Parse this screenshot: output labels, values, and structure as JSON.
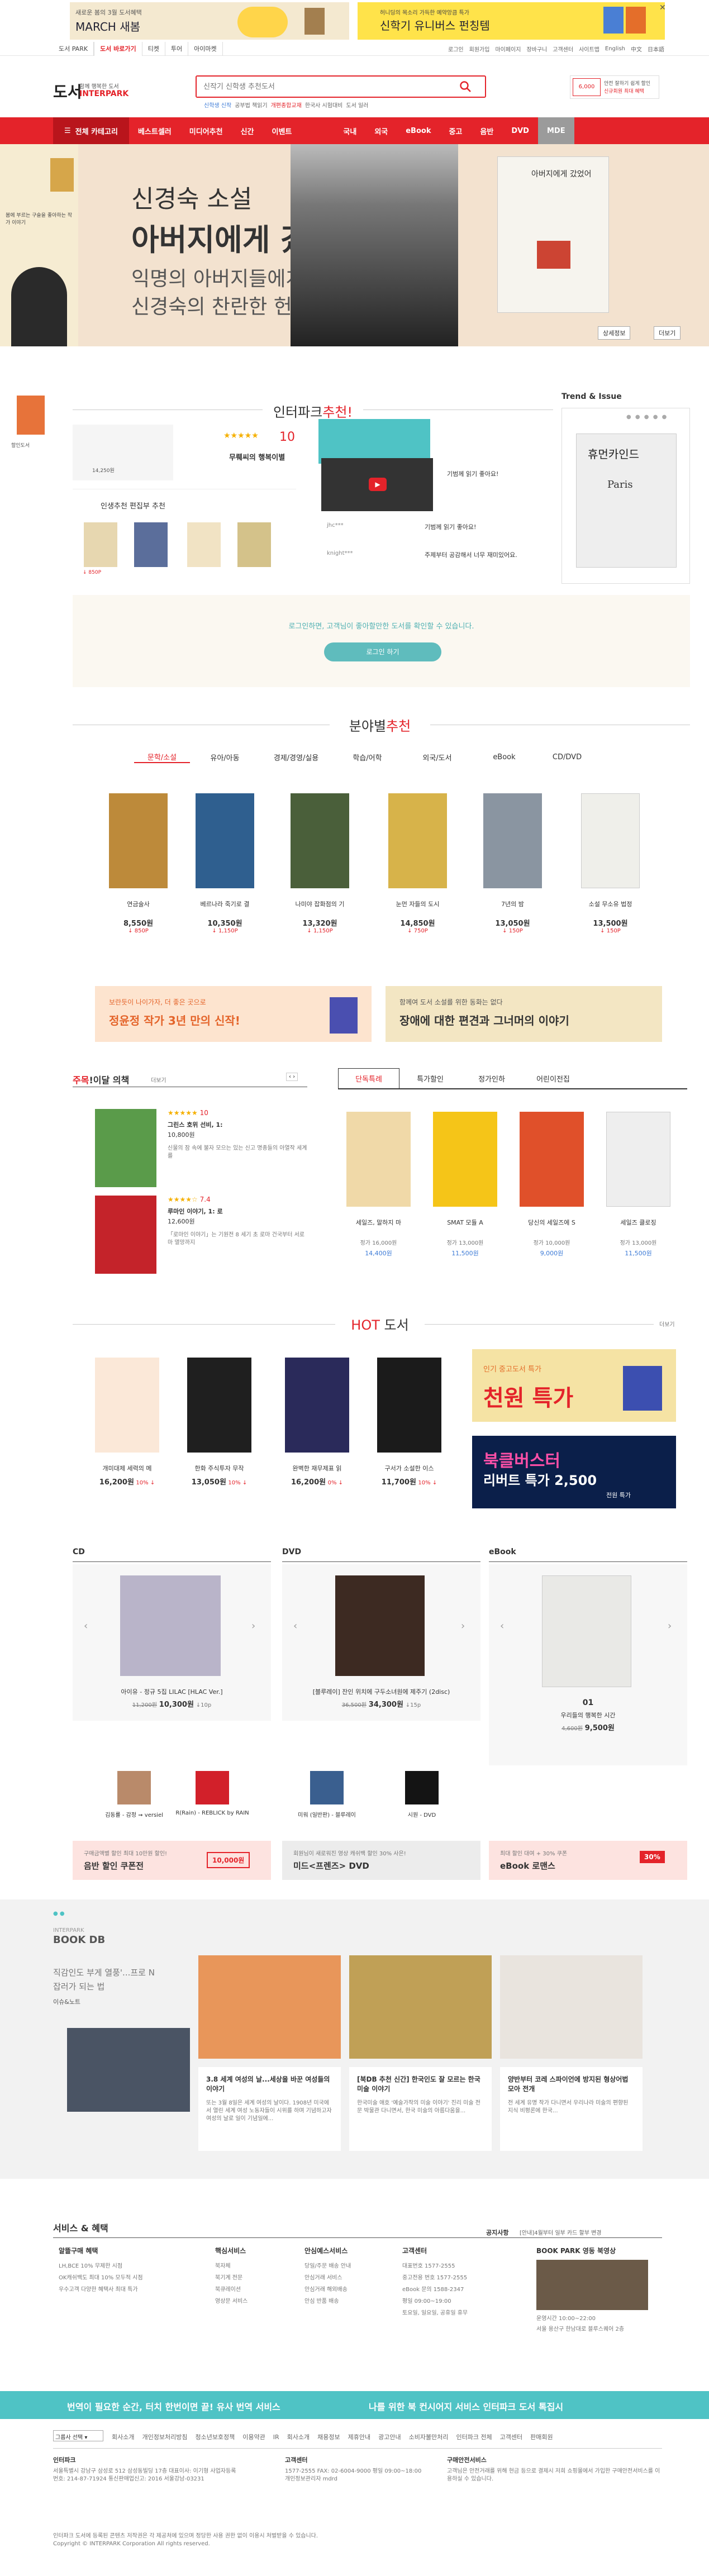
{
  "topbanner": {
    "left_line1": "새로운 봄의 3월 도서혜택",
    "left_line2": "MARCH 새봄",
    "right_line1": "허니딩의 목소리 가득한 예약앙큼 특가 ",
    "right_line2": "신학기 유니버스 펀칭템",
    "close": "✕"
  },
  "utilbar": {
    "services": [
      "도서 PARK",
      "도서 바로가기",
      "티켓",
      "투어",
      "아이마켓"
    ],
    "links": [
      "로그인",
      "회원가입",
      "마이페이지",
      "장바구니",
      "고객센터",
      "사이트맵",
      "English",
      "中文",
      "日本語"
    ]
  },
  "header": {
    "logo": "도서",
    "logo_sub_1": "함께 행복한 도서",
    "logo_sub_2": "INTERPARK",
    "search_placeholder": "신작기 신학생 추천도서",
    "keywords": [
      "신학생 신작",
      "공부법 책읽기",
      "개편종합교재",
      "한국사 시험대비",
      "도서 일러"
    ],
    "promo_line1": "안전 잘하기 쉽게 할인",
    "promo_line2": "신규회원 최대 혜택"
  },
  "gnb": {
    "menus": [
      "전체 카테고리",
      "베스트셀러",
      "미디어추천",
      "신간",
      "이벤트",
      "국내",
      "외국",
      "eBook",
      "중고",
      "음반",
      "DVD",
      "MDE"
    ]
  },
  "hero": {
    "side_text": "봄에 부르는 구슬을 좋아하는 작가 이야기",
    "title_1": "신경숙 소설",
    "title_2": "아버지에게 갔었어",
    "sub_1": "익명의 아버지들에게 바치는",
    "sub_2": "신경숙의 찬란한 헌사",
    "book_title": "아버지에게 갔었어",
    "btn_detail": "상세정보",
    "btn_more": "더보기"
  },
  "recommend": {
    "title_1": "인터파크",
    "title_2": "추천!",
    "trend_title": "Trend & Issue",
    "stars_label": "★★★★★",
    "rating": "10",
    "book_name": "무뤠씨의 행복이별",
    "mini_title": "인생추천 편집부 추천",
    "video_text": "기범께 읽기 좋아요!",
    "user_1": "jhc***",
    "user_2": "knight***",
    "comment_1": "기범께 읽기 좋아요!",
    "comment_2": "주제부터 공감해서 너무 재미있어요.",
    "login_prompt": "로그인하면, 고객님이 좋아할만한 도서를 확인할 수 있습니다.",
    "login_button": "로그인 하기",
    "trend_book": "휴먼카인드",
    "trend_book_sub": "Paris"
  },
  "category": {
    "title_1": "분야별",
    "title_2": "추천",
    "tabs": [
      "문학/소설",
      "유아/아동",
      "경제/경영/실용",
      "학습/어학",
      "외국/도서",
      "eBook",
      "CD/DVD"
    ],
    "books": [
      {
        "title": "연금술사",
        "price": "8,550원",
        "point": "↓ 850P"
      },
      {
        "title": "베르나라 죽기로 결",
        "price": "10,350원",
        "point": "↓ 1,150P"
      },
      {
        "title": "나미야 잡화점의 기",
        "price": "13,320원",
        "point": "↓ 1,150P"
      },
      {
        "title": "눈먼 자들의 도시",
        "price": "14,850원",
        "point": "↓ 750P"
      },
      {
        "title": "7년의 밤",
        "price": "13,050원",
        "point": "↓ 150P"
      },
      {
        "title": "소설 무소유 법정",
        "price": "13,500원",
        "point": "↓ 150P"
      }
    ],
    "banner_left_1": "보란듯이 나이가자, 더 좋은 곳으로",
    "banner_left_2": "정윤정 작가 3년 만의 신작!",
    "banner_right_1": "함께여 도서 소설를 위한 동화는 없다",
    "banner_right_2": "장애에 대한 편견과 그너머의 이야기"
  },
  "monthly": {
    "title_1": "주목",
    "title_2": "!이달 의책",
    "more": "더보기",
    "items": [
      {
        "stars": "★★★★★",
        "rating": "10",
        "name": "그린스 호위 선비, 1:",
        "price": "10,800원",
        "desc": "신물의 잠 속에 불자 모으는 있는 신고 명종들의 아열작 세계를"
      },
      {
        "stars": "★★★★☆",
        "rating": "7.4",
        "name": "루마인 이야기, 1: 로",
        "price": "12,600원",
        "desc": "「로마인 이야기」는 기원전 8 세기 초 로마 건국부터 서로마 멸망까지"
      }
    ],
    "tabs": [
      "단독특례",
      "특가할인",
      "정가인하",
      "어린이전집"
    ],
    "books": [
      {
        "title": "세일즈, 말하지 마",
        "price_1": "정가 16,000원",
        "price_2": "14,400원"
      },
      {
        "title": "SMAT 모듈 A",
        "price_1": "정가 13,000원",
        "price_2": "11,500원"
      },
      {
        "title": "당신의 세일즈에 S",
        "price_1": "정가 10,000원",
        "price_2": "9,000원"
      },
      {
        "title": "세일즈 클로징",
        "price_1": "정가 13,000원",
        "price_2": "11,500원"
      }
    ]
  },
  "hot": {
    "title_1": "HOT",
    "title_2": " 도서",
    "more": "더보기",
    "books": [
      {
        "title": "개미대제 세력의 메",
        "price": "16,200원",
        "pct": "10% ↓"
      },
      {
        "title": "한화 주식투자 무작",
        "price": "13,050원",
        "pct": "10% ↓"
      },
      {
        "title": "완벽한 재무제표 읽",
        "price": "16,200원",
        "pct": "0% ↓"
      },
      {
        "title": "구서가 소설한 이스",
        "price": "11,700원",
        "pct": "10% ↓"
      }
    ],
    "banner_top_1": "인기 중고도서 특가",
    "banner_top_2": "천원 특가",
    "banner_bot_1": "북클버스터",
    "banner_bot_2": "리버트 특가 2,500",
    "banner_bot_3": "전원 특가"
  },
  "media": {
    "cd_title": "CD",
    "dvd_title": "DVD",
    "ebook_title": "eBook",
    "cd_item": "아이유 - 정규 5집 LILAC [HLAC Ver.]",
    "cd_price_old": "11,200원",
    "cd_price": "10,300원",
    "cd_point": "↓10p",
    "dvd_item": "[블루레이] 잔인 위치에 구두소녀원에 제주기 (2disc)",
    "dvd_price_old": "36,500원",
    "dvd_price": "34,300원",
    "dvd_point": "↓15p",
    "ebook_item_title": "01",
    "ebook_item": "우리들의 행복한 시간",
    "ebook_price_old": "4,600원",
    "ebook_price": "9,500원",
    "cd_small_1": "김동률 - 감정 ➞ versiel",
    "cd_small_2": "R(Rain) - REBLICK by RAIN",
    "dvd_small_1": "미워 (일반판) - 블루레이",
    "dvd_small_2": "시원 - DVD",
    "cd_banner_1": "구매금액별 할인 최대 10만원 할인!",
    "cd_banner_2": "음반 할인 쿠폰전",
    "cd_banner_3": "10,000원",
    "dvd_banner_1": "회원님이 새로워진 영상 캐쉬백 할인 30% 사은!",
    "dvd_banner_2": "미드<프렌즈> DVD",
    "ebook_banner_1": "최대 할인 대여 + 30% 쿠폰",
    "ebook_banner_2": "eBook 로맨스",
    "ebook_banner_3": "30%"
  },
  "bookdb": {
    "header_1": "INTERPARK",
    "header_2": "BOOK DB",
    "side_line_1": "직감인도 부게 열풍'...프로 N",
    "side_line_2": "잡러가 되는 법",
    "side_line_3": "이슈&노트",
    "articles": [
      {
        "title": "3.8 세계 여성의 날...세상을 바꾼 여성들의 이야기",
        "body": "또는 3월 8일은 세계 여성의 날이다. 1908년 미국에서 열린 세계 여성 노동자들이 시위를 하며 기념하고자 여성의 날로 일이 기념일에..."
      },
      {
        "title": "[북DB 추천 신간] 한국인도 잘 모르는 한국 미술 이야기",
        "body": "한국미술 애호 '예술가작의 미술 이야기' 진리 미술 전문 박물관 다니면서, 한국 미술의 아름다움을..."
      },
      {
        "title": "양반부터 코레 스파이언에 방지된 형상어법 모아 전개",
        "body": "전 세계 유명 작가 다니면서 우리나라 미술의 편향된 지식 비평론에 한국..."
      }
    ]
  },
  "service": {
    "title": "서비스 & 혜택",
    "notice": "공지사항",
    "notice_text": "[안내]4월부터 일부 카드 할부 변경",
    "col_1_title": "알뜰구매 혜택",
    "col_1_items": [
      "LH,BCE 10% 무제한 시점",
      "OK캐쉬백도 최대 10% 모두적 시점",
      "우수고객 다양한 혜택사 최대 특가"
    ],
    "col_2_title": "핵심서비스",
    "col_2_items": [
      "북자체",
      "북기계 전문",
      "북큐레이션",
      "영상문 서비스"
    ],
    "col_3_title": "안심예스서비스",
    "col_3_items": [
      "당일/주문 배송 안내",
      "안심거래 서비스",
      "안심거래 해외배송",
      "안심 반품 배송"
    ],
    "col_4_title": "고객센터",
    "col_4_items": [
      "대표번호 1577-2555",
      "중고전용 번호 1577-2555",
      "eBook 문의 1588-2347",
      "평일 09:00~19:00",
      "토요일, 일요일, 공휴일 휴무"
    ],
    "park_title": "BOOK PARK",
    "park_sub": "영동 북영상",
    "park_hours": "운영시간 10:00~22:00",
    "park_addr": "서울 용산구 한남대로 블루스퀘어 2층"
  },
  "bluebar": {
    "text_1": "번역이 필요한 순간, 터치 한번이면 끝! 유사 번역 서비스",
    "text_2": "나를 위한 북 컨시어지 서비스 인터파크 도서 톡집시"
  },
  "footer": {
    "select_label": "그룹사 선택",
    "links": [
      "회사소개",
      "개인정보처리방침",
      "청소년보호정책",
      "이용약관",
      "IR",
      "회사소개",
      "채용정보",
      "제휴안내",
      "광고안내",
      "소비자불만처리",
      "인터파크 전체",
      "고객센터",
      "판매회원"
    ],
    "col_1_title": "인터파크",
    "col_1_body": "서울특별시 강남구 삼성로 512 삼성동빌딩 17층 대표이사: 이기형 사업자등록번호: 214-87-71924 통신판매업신고: 2016 서울강남-03231",
    "col_2_title": "고객센터",
    "col_2_body": "1577-2555 FAX: 02-6004-9000 평일 09:00~18:00 개인정보관리자 mdrd",
    "col_3_title": "구매안전서비스",
    "col_3_body": "고객님은 안전거래를 위해 현금 등으로 결제시 저희 쇼핑몰에서 가입한 구매안전서비스를 이용하실 수 있습니다.",
    "copyright": "인터파크 도서에 등록된 콘텐츠 저작권은 각 제공처에 있으며 정당한 사용 권한 없이 이용시 처벌받을 수 있습니다.",
    "copyright_2": "Copyright © INTERPARK Corporation All rights reserved."
  },
  "colors": {
    "brand_red": "#e4232a",
    "teal": "#4fc3c5",
    "gnb": "#e4232a"
  }
}
